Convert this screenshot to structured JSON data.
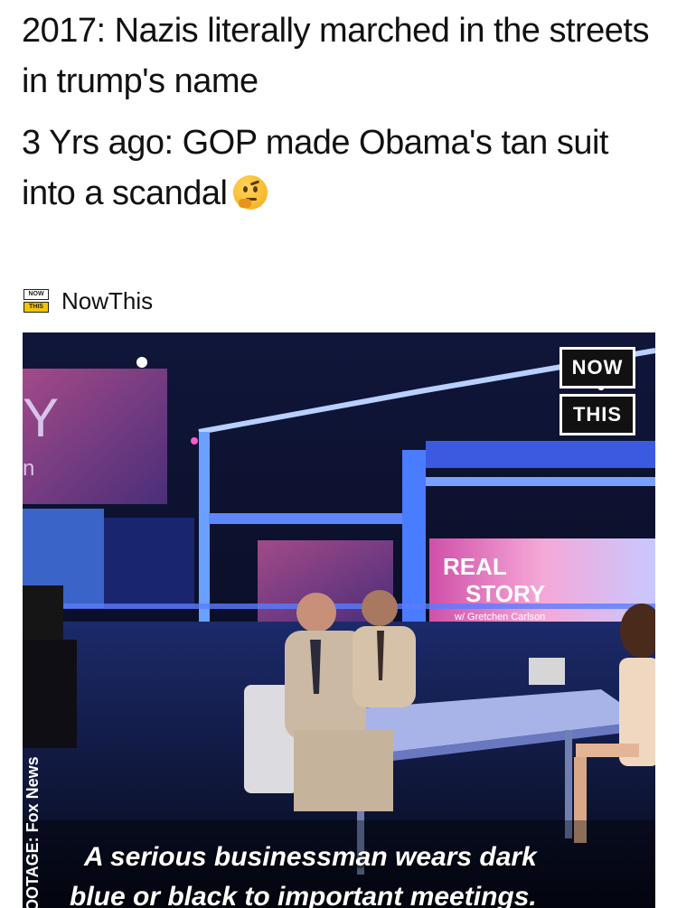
{
  "post": {
    "line1": "2017: Nazis literally marched in the streets in trump's name",
    "line2": "3 Yrs ago: GOP made Obama's tan suit into a scandal",
    "emoji": "thinking-face-emoji"
  },
  "source": {
    "logo_top": "NOW",
    "logo_bottom": "THIS",
    "name": "NowThis"
  },
  "video": {
    "badge_top": "NOW",
    "badge_bottom": "THIS",
    "footage_credit": "FOOTAGE: Fox News",
    "set_sign_line1": "REAL",
    "set_sign_line2": "STORY",
    "set_sign_line3": "w/ Gretchen Carlson",
    "caption_line1": "A serious businessman wears dark",
    "caption_line2": "blue or black to important meetings."
  }
}
